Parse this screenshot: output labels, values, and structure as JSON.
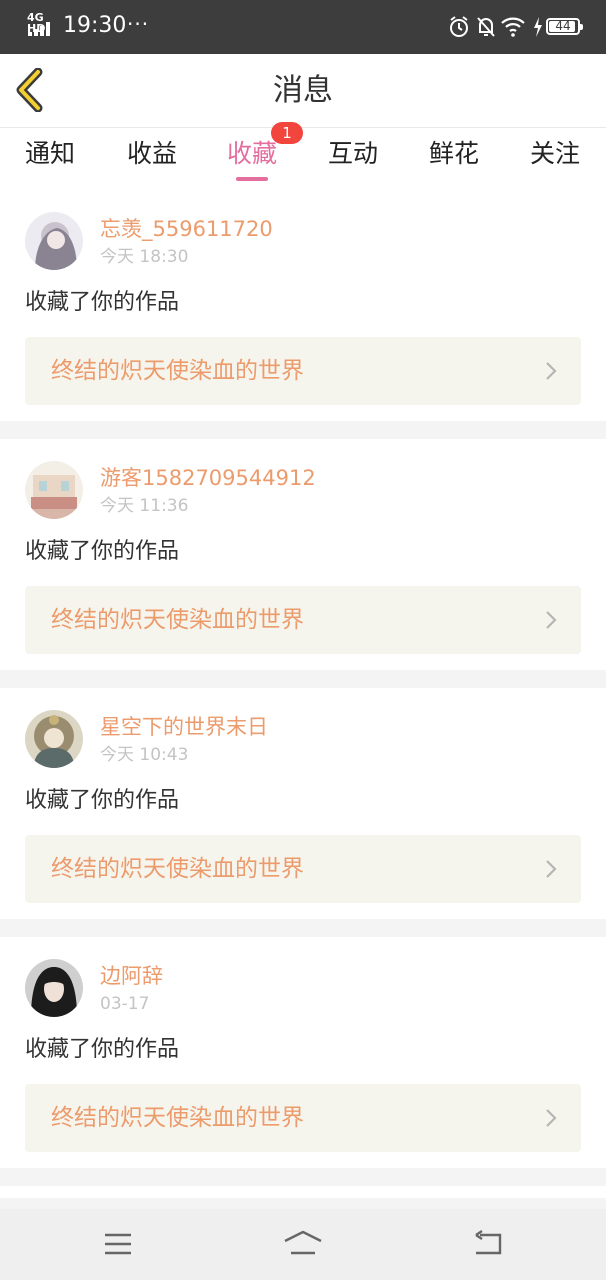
{
  "status_bar": {
    "network": "4G HD",
    "time": "19:30",
    "dots": "···",
    "battery": "44"
  },
  "navbar": {
    "title": "消息"
  },
  "tabs": [
    {
      "label": "通知"
    },
    {
      "label": "收益"
    },
    {
      "label": "收藏",
      "active": true,
      "badge": "1"
    },
    {
      "label": "互动"
    },
    {
      "label": "鲜花"
    },
    {
      "label": "关注"
    }
  ],
  "colors": {
    "accent": "#e46f9f",
    "badge": "#f2453d",
    "username": "#ec9b6c",
    "work_bg": "#f6f5ed"
  },
  "items": [
    {
      "username": "忘羡_559611720",
      "time": "今天 18:30",
      "action": "收藏了你的作品",
      "work_title": "终结的炽天使染血的世界"
    },
    {
      "username": "游客1582709544912",
      "time": "今天 11:36",
      "action": "收藏了你的作品",
      "work_title": "终结的炽天使染血的世界"
    },
    {
      "username": "星空下的世界末日",
      "time": "今天 10:43",
      "action": "收藏了你的作品",
      "work_title": "终结的炽天使染血的世界"
    },
    {
      "username": "边阿辞",
      "time": "03-17",
      "action": "收藏了你的作品",
      "work_title": "终结的炽天使染血的世界"
    }
  ],
  "system_nav": {
    "icons": [
      "menu-icon",
      "home-icon",
      "back-icon"
    ]
  }
}
